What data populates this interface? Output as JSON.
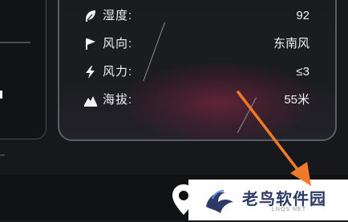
{
  "weather": {
    "rows": [
      {
        "icon": "leaf-icon",
        "label": "湿度:",
        "value": "92"
      },
      {
        "icon": "flag-icon",
        "label": "风向:",
        "value": "东南风"
      },
      {
        "icon": "lightning-icon",
        "label": "风力:",
        "value": "≤3"
      },
      {
        "icon": "mountain-icon",
        "label": "海拔:",
        "value": "55米"
      }
    ]
  },
  "watermark": {
    "title": "老鸟软件园",
    "subtitle": "LNQS.NET"
  },
  "colors": {
    "background": "#17181b",
    "card_border": "#5a5d62",
    "arrow": "#f07a2a",
    "watermark_text": "#2e3a66"
  }
}
